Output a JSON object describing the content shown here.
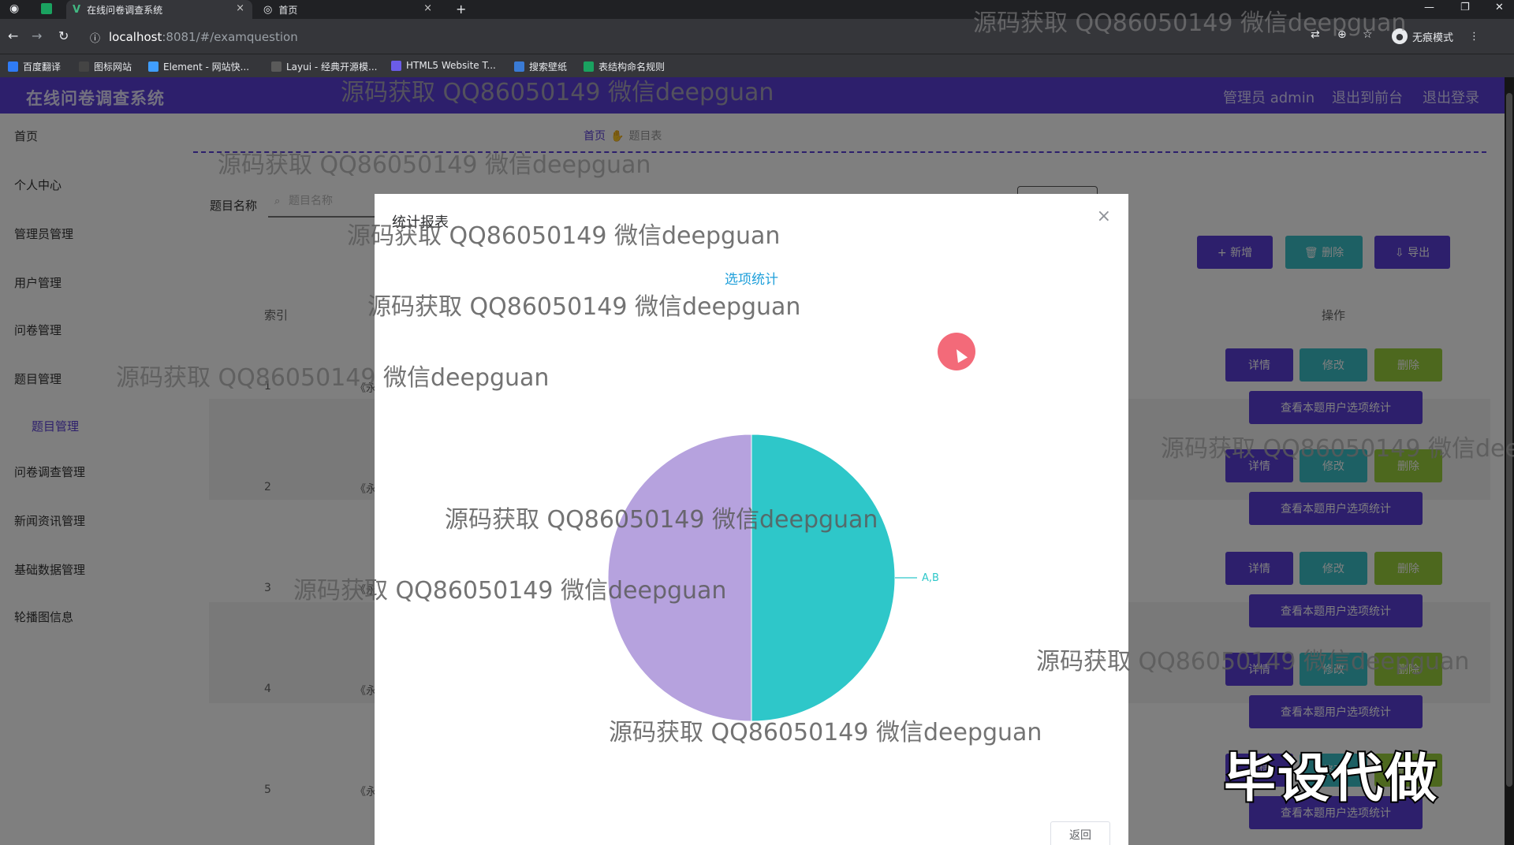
{
  "browser": {
    "tabs": [
      {
        "title": "在线问卷调查系统",
        "close": "×"
      },
      {
        "title": "首页",
        "close": "×"
      }
    ],
    "new_tab": "+",
    "window_controls": {
      "minimize": "—",
      "restore": "❐",
      "close": "✕"
    },
    "nav": {
      "back": "←",
      "forward": "→",
      "reload": "↻",
      "info": "ⓘ"
    },
    "url_host": "localhost",
    "url_rest": ":8081/#/examquestion",
    "incognito_label": "无痕模式",
    "bookmarks": [
      {
        "label": "百度翻译",
        "color": "#2f7bf5"
      },
      {
        "label": "图标网站",
        "color": "#444444"
      },
      {
        "label": "Element - 网站快...",
        "color": "#409eff"
      },
      {
        "label": "Layui - 经典开源模...",
        "color": "#5a5a5a"
      },
      {
        "label": "HTML5 Website T...",
        "color": "#6b5ce7"
      },
      {
        "label": "搜索壁纸",
        "color": "#3a7bd5"
      },
      {
        "label": "表结构命名规则",
        "color": "#1aa260"
      }
    ]
  },
  "app": {
    "title": "在线问卷调查系统",
    "header_links": [
      "管理员 admin",
      "退出到前台",
      "退出登录"
    ],
    "menu": [
      "首页",
      "个人中心",
      "管理员管理",
      "用户管理",
      "问卷管理",
      "题目管理",
      "题目管理",
      "问卷调查管理",
      "新闻资讯管理",
      "基础数据管理",
      "轮播图信息"
    ],
    "breadcrumb": {
      "home": "首页",
      "sep": "✋",
      "current": "题目表"
    },
    "search": {
      "label": "题目名称",
      "placeholder": "题目名称"
    },
    "toolbar": {
      "add": "+ 新增",
      "delete": "🗑 删除",
      "export": "⇩ 导出"
    },
    "table": {
      "headers": {
        "index": "索引",
        "actions": "操作"
      },
      "rows": [
        {
          "index": "1",
          "title": "《永"
        },
        {
          "index": "2",
          "title": "《永"
        },
        {
          "index": "3",
          "title": "《永"
        },
        {
          "index": "4",
          "title": "《永"
        },
        {
          "index": "5",
          "title": "《永"
        }
      ],
      "actions": {
        "view": "详情",
        "edit": "修改",
        "del": "删除",
        "stat": "查看本题用户选项统计"
      }
    }
  },
  "modal": {
    "title": "统计报表",
    "close": "×",
    "back_label": "返回"
  },
  "chart_data": {
    "type": "pie",
    "title": "选项统计",
    "slices": [
      {
        "label": "A,B",
        "value": 1,
        "color": "#2ec7c9"
      },
      {
        "label": "",
        "value": 1,
        "color": "#b6a2de"
      }
    ]
  },
  "overlay": {
    "watermark": "源码获取 QQ86050149 微信deepguan",
    "promo": "毕设代做"
  }
}
